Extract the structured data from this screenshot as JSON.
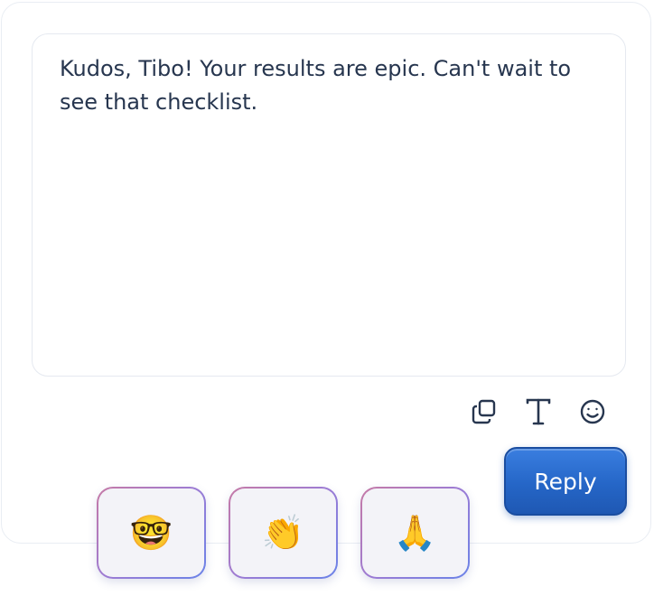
{
  "message": {
    "text": "Kudos, Tibo! Your results are epic. Can't wait to see that checklist."
  },
  "toolbar": {
    "icons": [
      "copy-icon",
      "text-format-icon",
      "emoji-icon"
    ]
  },
  "reply_button": {
    "label": "Reply"
  },
  "reactions": [
    {
      "emoji": "🤓",
      "name": "nerd-face"
    },
    {
      "emoji": "👏",
      "name": "clapping-hands"
    },
    {
      "emoji": "🙏",
      "name": "folded-hands"
    }
  ],
  "colors": {
    "text": "#27364f",
    "reply_bg": "#2566c7",
    "reply_border": "#1a4da0",
    "reaction_border_start": "#c67aa6",
    "reaction_border_end": "#6a83e8",
    "reaction_bg": "#f3f3f8"
  }
}
